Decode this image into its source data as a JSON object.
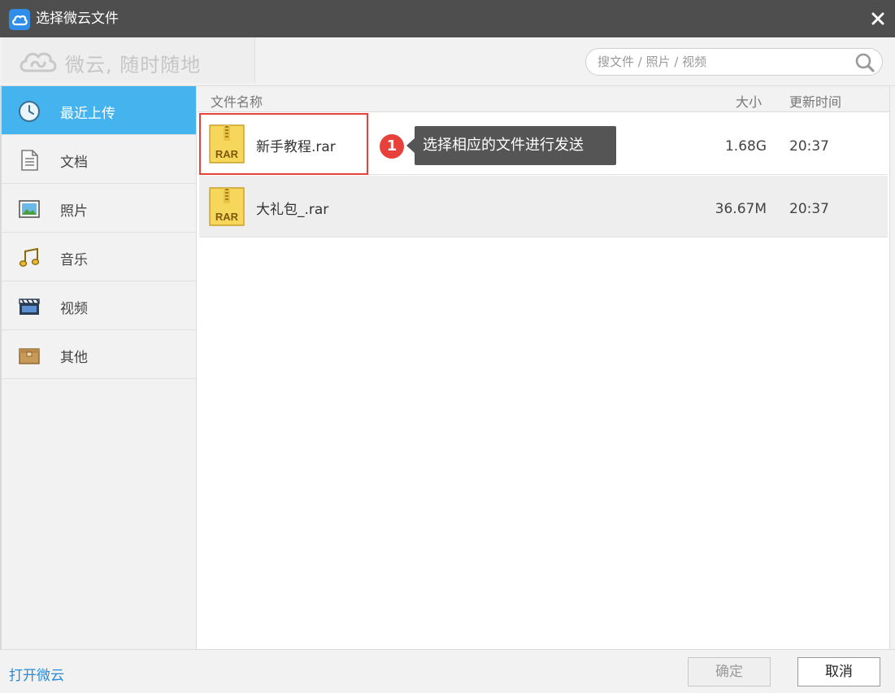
{
  "window": {
    "title": "选择微云文件",
    "app_icon": "weiyun-cloud-icon",
    "close_icon": "close-icon"
  },
  "brand": {
    "slogan": "微云, 随时随地",
    "logo_icon": "cloud-logo-icon"
  },
  "search": {
    "placeholder": "搜文件 / 照片 / 视频",
    "value": "",
    "icon": "search-icon"
  },
  "sidebar": {
    "items": [
      {
        "label": "最近上传",
        "icon": "clock-icon",
        "active": true
      },
      {
        "label": "文档",
        "icon": "document-icon",
        "active": false
      },
      {
        "label": "照片",
        "icon": "photo-icon",
        "active": false
      },
      {
        "label": "音乐",
        "icon": "music-icon",
        "active": false
      },
      {
        "label": "视频",
        "icon": "video-icon",
        "active": false
      },
      {
        "label": "其他",
        "icon": "box-icon",
        "active": false
      }
    ]
  },
  "table": {
    "headers": {
      "name": "文件名称",
      "size": "大小",
      "time": "更新时间"
    },
    "rows": [
      {
        "name": "新手教程.rar",
        "size": "1.68G",
        "time": "20:37",
        "icon": "rar-archive-icon",
        "icon_text": "RAR"
      },
      {
        "name": "大礼包_.rar",
        "size": "36.67M",
        "time": "20:37",
        "icon": "rar-archive-icon",
        "icon_text": "RAR"
      }
    ]
  },
  "annotation": {
    "step": "1",
    "text": "选择相应的文件进行发送"
  },
  "footer": {
    "open_link": "打开微云",
    "ok_label": "确定",
    "cancel_label": "取消"
  },
  "colors": {
    "title_bar": "#4e4e4e",
    "accent_blue": "#45b3ee",
    "highlight_red": "#e8413c",
    "link_blue": "#2a8ad6"
  }
}
